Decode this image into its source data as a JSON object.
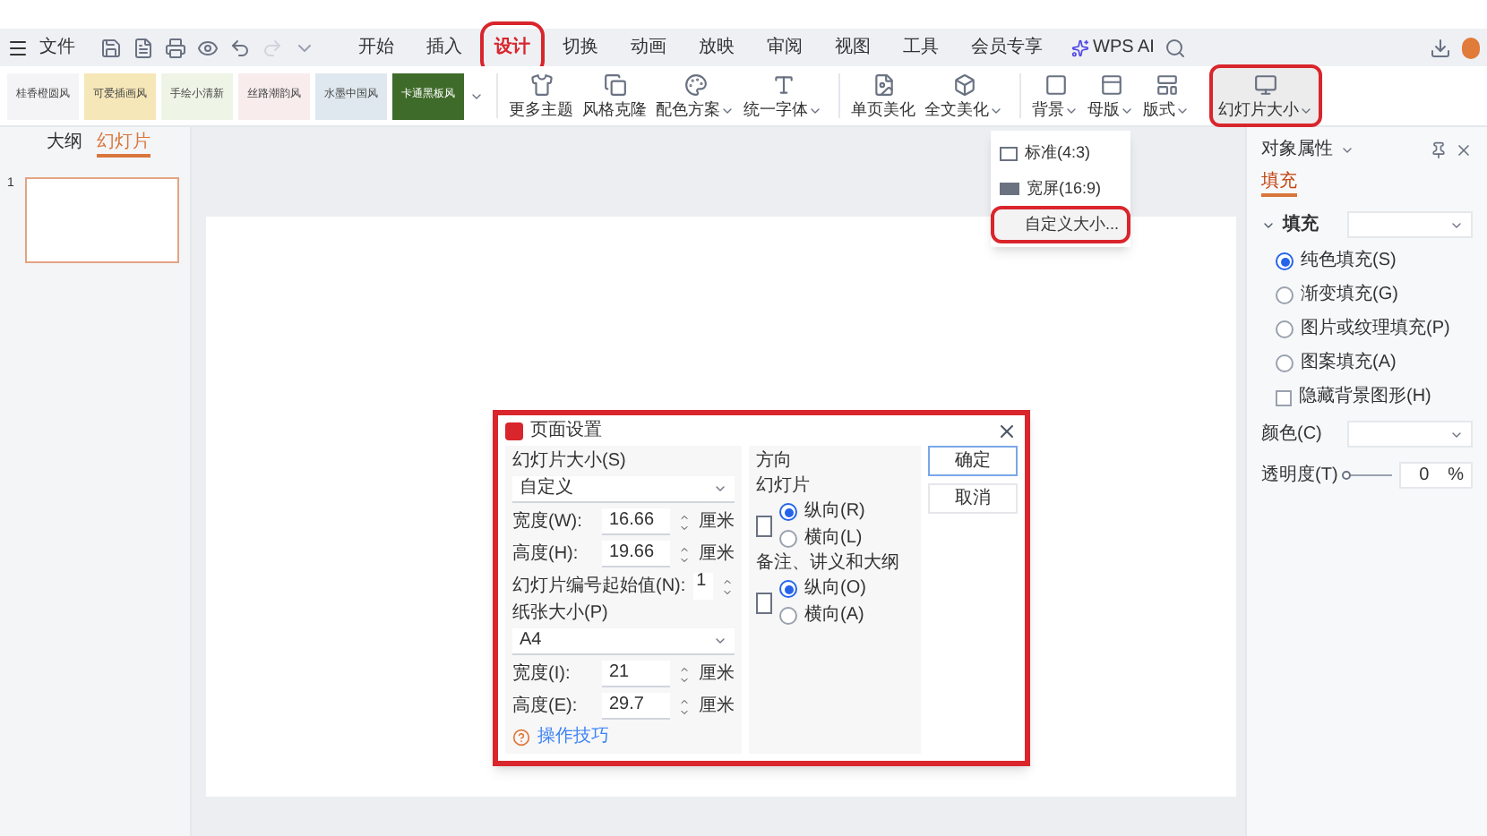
{
  "quick_access": {
    "menu_label": "文件"
  },
  "tabs": [
    {
      "label": "开始",
      "selected": false,
      "highlighted": false
    },
    {
      "label": "插入",
      "selected": false,
      "highlighted": false
    },
    {
      "label": "设计",
      "selected": true,
      "highlighted": true
    },
    {
      "label": "切换",
      "selected": false,
      "highlighted": false
    },
    {
      "label": "动画",
      "selected": false,
      "highlighted": false
    },
    {
      "label": "放映",
      "selected": false,
      "highlighted": false
    },
    {
      "label": "审阅",
      "selected": false,
      "highlighted": false
    },
    {
      "label": "视图",
      "selected": false,
      "highlighted": false
    },
    {
      "label": "工具",
      "selected": false,
      "highlighted": false
    },
    {
      "label": "会员专享",
      "selected": false,
      "highlighted": false
    }
  ],
  "ai_tab": {
    "label": "WPS AI"
  },
  "themes": [
    {
      "label": "桂香橙圆风",
      "color": "#f4f4f6"
    },
    {
      "label": "可爱插画风",
      "color": "#f6e7b8"
    },
    {
      "label": "手绘小清新",
      "color": "#eef5e6"
    },
    {
      "label": "丝路潮韵风",
      "color": "#f8ecec"
    },
    {
      "label": "水墨中国风",
      "color": "#dfe8ee"
    },
    {
      "label": "卡通黑板风",
      "color": "#3f6b2a"
    }
  ],
  "ribbon_groups": [
    [
      {
        "label": "更多主题",
        "kind": "shirt",
        "dropdown": false
      },
      {
        "label": "风格克隆",
        "kind": "copy",
        "dropdown": false
      },
      {
        "label": "配色方案",
        "kind": "palette",
        "dropdown": true
      },
      {
        "label": "统一字体",
        "kind": "font",
        "dropdown": true
      }
    ],
    [
      {
        "label": "单页美化",
        "kind": "page",
        "dropdown": false
      },
      {
        "label": "全文美化",
        "kind": "box",
        "dropdown": true
      }
    ],
    [
      {
        "label": "背景",
        "kind": "background",
        "dropdown": true
      },
      {
        "label": "母版",
        "kind": "master",
        "dropdown": true
      },
      {
        "label": "版式",
        "kind": "layout",
        "dropdown": true
      }
    ]
  ],
  "slide_size_button": {
    "label": "幻灯片大小",
    "dropdown": true,
    "highlighted": true
  },
  "slide_size_menu": [
    {
      "label": "标准(4:3)",
      "kind": "standard",
      "highlighted": false
    },
    {
      "label": "宽屏(16:9)",
      "kind": "wide",
      "highlighted": false
    },
    {
      "label": "自定义大小...",
      "kind": "custom",
      "highlighted": true
    }
  ],
  "left_panel": {
    "tabs": [
      {
        "label": "大纲",
        "selected": false
      },
      {
        "label": "幻灯片",
        "selected": true
      }
    ],
    "slides": [
      {
        "number": "1",
        "selected": true
      }
    ]
  },
  "dialog": {
    "title": "页面设置",
    "highlighted": true,
    "slide_size_label": "幻灯片大小(S)",
    "slide_size_value": "自定义",
    "slide_fields": [
      {
        "label": "宽度(W):",
        "value": "16.66",
        "unit": "厘米"
      },
      {
        "label": "高度(H):",
        "value": "19.66",
        "unit": "厘米"
      }
    ],
    "numbering": {
      "label": "幻灯片编号起始值(N):",
      "value": "1"
    },
    "paper_size_label": "纸张大小(P)",
    "paper_size_value": "A4",
    "paper_fields": [
      {
        "label": "宽度(I):",
        "value": "21",
        "unit": "厘米"
      },
      {
        "label": "高度(E):",
        "value": "29.7",
        "unit": "厘米"
      }
    ],
    "tips_link": "操作技巧",
    "orientation_title": "方向",
    "orientation_groups": [
      {
        "title": "幻灯片",
        "options": [
          {
            "label": "纵向(R)",
            "selected": true
          },
          {
            "label": "横向(L)",
            "selected": false
          }
        ]
      },
      {
        "title": "备注、讲义和大纲",
        "options": [
          {
            "label": "纵向(O)",
            "selected": true
          },
          {
            "label": "横向(A)",
            "selected": false
          }
        ]
      }
    ],
    "buttons": [
      "确定",
      "取消"
    ]
  },
  "properties": {
    "title": "对象属性",
    "tabs": [
      {
        "label": "填充",
        "selected": true
      }
    ],
    "section": "填充",
    "fill_options": [
      {
        "label": "纯色填充(S)",
        "selected": true
      },
      {
        "label": "渐变填充(G)",
        "selected": false
      },
      {
        "label": "图片或纹理填充(P)",
        "selected": false
      },
      {
        "label": "图案填充(A)",
        "selected": false
      }
    ],
    "hide_background": {
      "label": "隐藏背景图形(H)",
      "checked": false
    },
    "color_label": "颜色(C)",
    "transparency": {
      "label": "透明度(T)",
      "level": 0,
      "value": "0",
      "unit": "%"
    }
  }
}
